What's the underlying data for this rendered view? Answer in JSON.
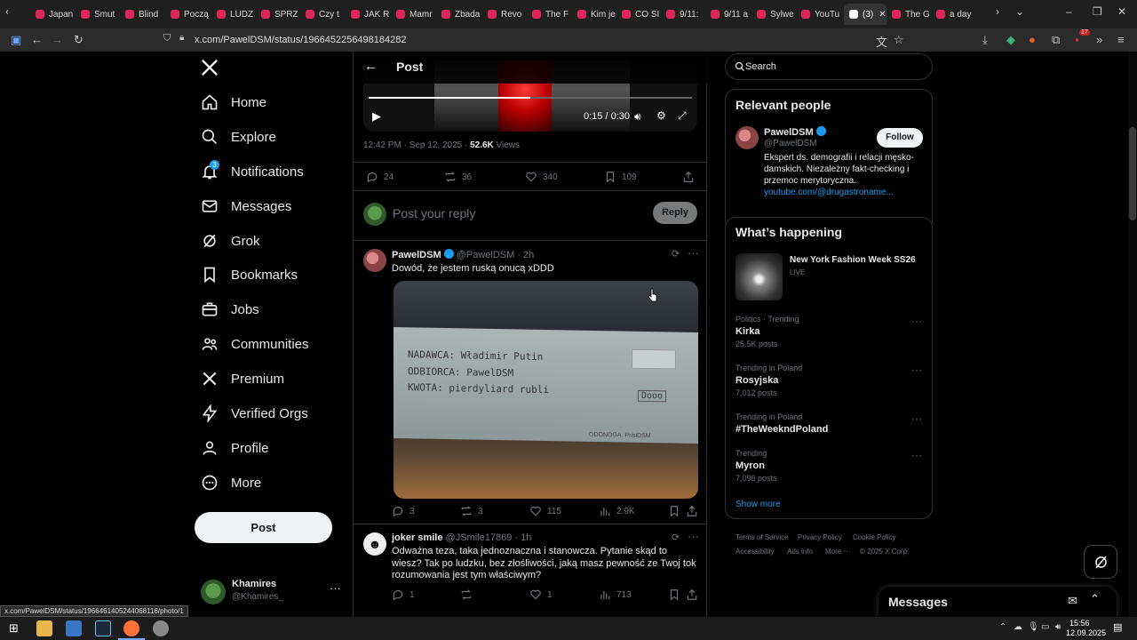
{
  "browser": {
    "tabs": [
      {
        "label": "Japan"
      },
      {
        "label": "Smut"
      },
      {
        "label": "Blind"
      },
      {
        "label": "Począ"
      },
      {
        "label": "LUDZ"
      },
      {
        "label": "SPRZ"
      },
      {
        "label": "Czy t"
      },
      {
        "label": "JAK R"
      },
      {
        "label": "Mamr"
      },
      {
        "label": "Zbada"
      },
      {
        "label": "Revo"
      },
      {
        "label": "The F"
      },
      {
        "label": "Kim je"
      },
      {
        "label": "CO SI"
      },
      {
        "label": "9/11:"
      },
      {
        "label": "9/11 a"
      },
      {
        "label": "Sylwe"
      },
      {
        "label": "YouTu"
      },
      {
        "label": "(3)"
      },
      {
        "label": "The G"
      },
      {
        "label": "a day"
      }
    ],
    "url": "x.com/PawelDSM/status/1966452256498184282",
    "extension_badge": "17",
    "hover_status_url": "x.com/PawelDSM/status/1966461405244068116/photo/1"
  },
  "nav": {
    "items": [
      {
        "label": "Home",
        "icon": "home-icon"
      },
      {
        "label": "Explore",
        "icon": "search-icon"
      },
      {
        "label": "Notifications",
        "icon": "bell-icon"
      },
      {
        "label": "Messages",
        "icon": "envelope-icon"
      },
      {
        "label": "Grok",
        "icon": "grok-icon"
      },
      {
        "label": "Bookmarks",
        "icon": "bookmark-icon"
      },
      {
        "label": "Jobs",
        "icon": "briefcase-icon"
      },
      {
        "label": "Communities",
        "icon": "people-icon"
      },
      {
        "label": "Premium",
        "icon": "x-logo-icon"
      },
      {
        "label": "Verified Orgs",
        "icon": "lightning-icon"
      },
      {
        "label": "Profile",
        "icon": "person-icon"
      },
      {
        "label": "More",
        "icon": "more-circle-icon"
      }
    ],
    "notifications_badge": "3",
    "post_label": "Post",
    "account": {
      "name": "Khamires",
      "handle": "@Khamires_"
    }
  },
  "header": {
    "title": "Post"
  },
  "main_post": {
    "video_time": "0:15 / 0:30",
    "timestamp": "12:42 PM · Sep 12, 2025 · ",
    "views_count": "52.6K",
    "views_label": " Views",
    "stats": {
      "replies": "24",
      "reposts": "36",
      "likes": "340",
      "bookmarks": "109"
    },
    "reply_placeholder": "Post your reply",
    "reply_button": "Reply"
  },
  "replies": [
    {
      "name": "PawelDSM",
      "handle": "@PawelDSM · 2h",
      "text": "Dowód, że jestem ruską onucą xDDD",
      "image_text": {
        "line1": "NADAWCA: Władimir Putin",
        "line2": "ODBIORCA: PawelDSM",
        "line3": "KWOTA: pierdyliard rubli",
        "amount": "Dooo",
        "signature": "ODONOGA. PrisiDSM"
      },
      "stats": {
        "replies": "3",
        "reposts": "3",
        "likes": "115",
        "views": "2.9K"
      }
    },
    {
      "name": "joker smile",
      "handle": "@JSmile17869 · 1h",
      "text": "Odważna teza, taka jednoznaczna i stanowcza. Pytanie skąd to wiesz? Tak po ludzku, bez złośliwości, jaką masz pewność ze Twoj tok rozumowania jest tym właściwym?",
      "stats": {
        "replies": "1",
        "reposts": "",
        "likes": "1",
        "views": "713"
      }
    }
  ],
  "search": {
    "placeholder": "Search"
  },
  "relevant_people": {
    "title": "Relevant people",
    "name": "PawelDSM",
    "handle": "@PawelDSM",
    "follow_label": "Follow",
    "bio": "Ekspert ds. demografii i relacji męsko-damskich. Niezależny fakt-checking i przemoc merytoryczna. ",
    "link": "youtube.com/@drugastroname..."
  },
  "whats_happening": {
    "title": "What’s happening",
    "featured": {
      "name": "New York Fashion Week SS26",
      "status": "LIVE"
    },
    "trends": [
      {
        "context": "Politics · Trending",
        "name": "Kirka",
        "count": "25.5K posts"
      },
      {
        "context": "Trending in Poland",
        "name": "Rosyjska",
        "count": "7,012 posts"
      },
      {
        "context": "Trending in Poland",
        "name": "#TheWeekndPoland",
        "count": ""
      },
      {
        "context": "Trending",
        "name": "Myron",
        "count": "7,096 posts"
      }
    ],
    "show_more": "Show more"
  },
  "footer": {
    "links": [
      "Terms of Service",
      "Privacy Policy",
      "Cookie Policy",
      "Accessibility",
      "Ads info",
      "More ···",
      "© 2025 X Corp."
    ]
  },
  "messages_drawer": {
    "title": "Messages"
  },
  "taskbar": {
    "time": "15:56",
    "date": "12.09.2025"
  },
  "colors": {
    "accent": "#1d9bf0",
    "background": "#000000",
    "border": "#2f3336",
    "muted": "#71767b"
  }
}
